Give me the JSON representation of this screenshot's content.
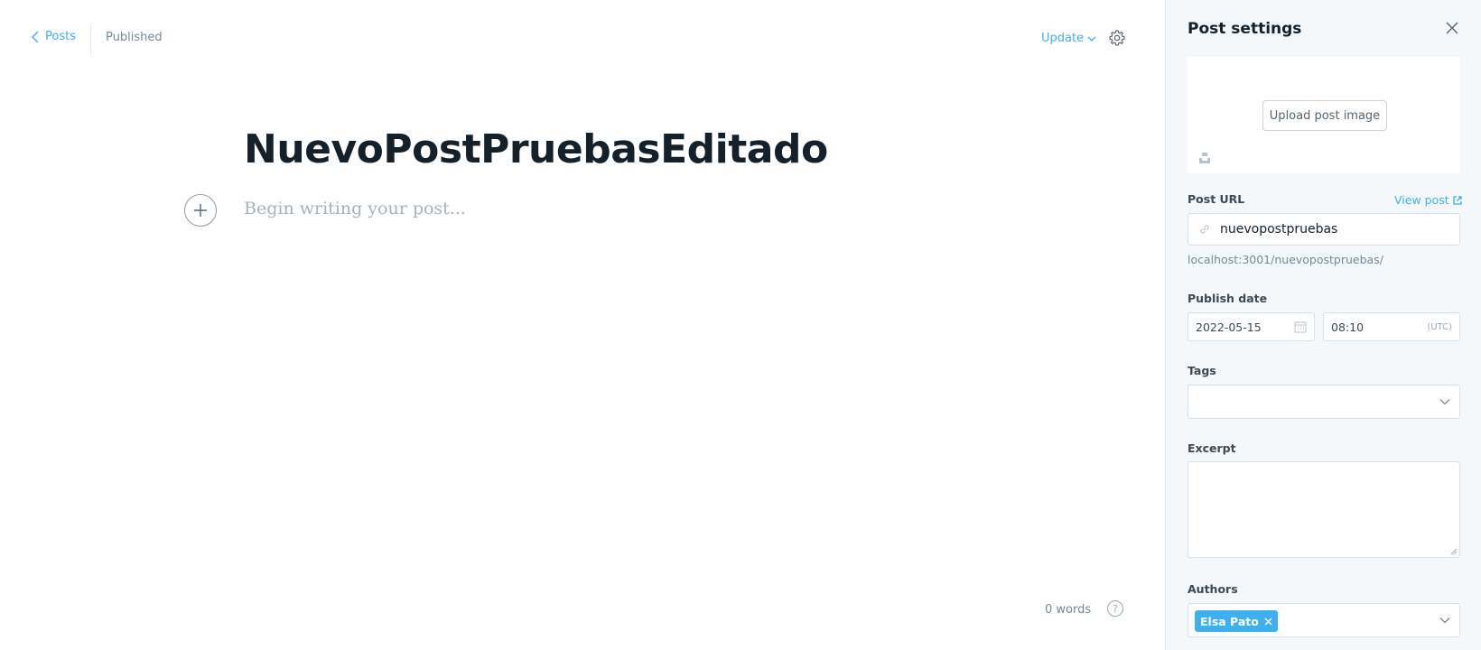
{
  "header": {
    "back_label": "Posts",
    "status": "Published",
    "update_label": "Update"
  },
  "editor": {
    "title": "NuevoPostPruebasEditado",
    "body_placeholder": "Begin writing your post...",
    "word_count": "0 words",
    "help_label": "?"
  },
  "settings": {
    "title": "Post settings",
    "upload_label": "Upload post image",
    "post_url_label": "Post URL",
    "view_post_label": "View post",
    "post_url_value": "nuevopostpruebas",
    "post_url_full": "localhost:3001/nuevopostpruebas/",
    "publish_date_label": "Publish date",
    "publish_date": "2022-05-15",
    "publish_time": "08:10",
    "timezone": "(UTC)",
    "tags_label": "Tags",
    "excerpt_label": "Excerpt",
    "authors_label": "Authors",
    "authors": [
      "Elsa Pato"
    ]
  },
  "colors": {
    "accent": "#3eb0ef",
    "panel_bg": "#f4f8fb",
    "text_dark": "#15212a",
    "text_muted": "#738a94"
  }
}
